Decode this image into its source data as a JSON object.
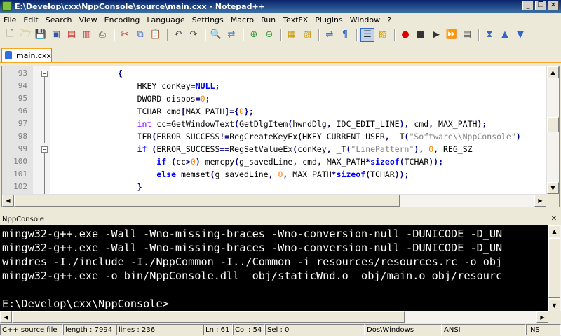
{
  "window": {
    "title": "E:\\Develop\\cxx\\NppConsole\\source\\main.cxx - Notepad++"
  },
  "menu": [
    "File",
    "Edit",
    "Search",
    "View",
    "Encoding",
    "Language",
    "Settings",
    "Macro",
    "Run",
    "TextFX",
    "Plugins",
    "Window",
    "?"
  ],
  "tabs": [
    {
      "label": "main.cxx"
    }
  ],
  "editor": {
    "line_numbers": [
      "93",
      "94",
      "95",
      "96",
      "97",
      "98",
      "99",
      "100",
      "101",
      "102"
    ]
  },
  "console": {
    "title": "NppConsole",
    "lines": [
      "mingw32-g++.exe -Wall -Wno-missing-braces -Wno-conversion-null -DUNICODE -D_UN",
      "mingw32-g++.exe -Wall -Wno-missing-braces -Wno-conversion-null -DUNICODE -D_UN",
      "windres -I./include -I./NppCommon -I../Common -i resources/resources.rc -o obj",
      "mingw32-g++.exe -o bin/NppConsole.dll  obj/staticWnd.o  obj/main.o obj/resourc",
      "",
      "E:\\Develop\\cxx\\NppConsole>"
    ]
  },
  "status": {
    "file_type": "C++ source file",
    "length": "length : 7994",
    "lines": "lines : 236",
    "ln": "Ln : 61",
    "col": "Col : 54",
    "sel": "Sel : 0",
    "eol": "Dos\\Windows",
    "encoding": "ANSI",
    "mode": "INS"
  }
}
